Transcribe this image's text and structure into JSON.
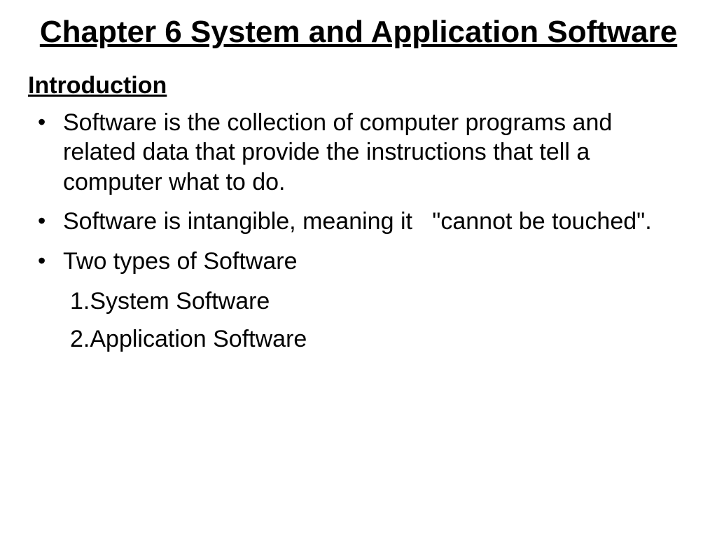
{
  "title": "Chapter 6 System and Application Software",
  "subheading": "Introduction",
  "bullets": [
    "Software is the collection of computer programs and related data that provide the instructions that tell a computer what to do.",
    "Software is intangible, meaning it   \"cannot be touched\".",
    "Two types of Software"
  ],
  "subitems": [
    "1.System Software",
    "2.Application Software"
  ]
}
